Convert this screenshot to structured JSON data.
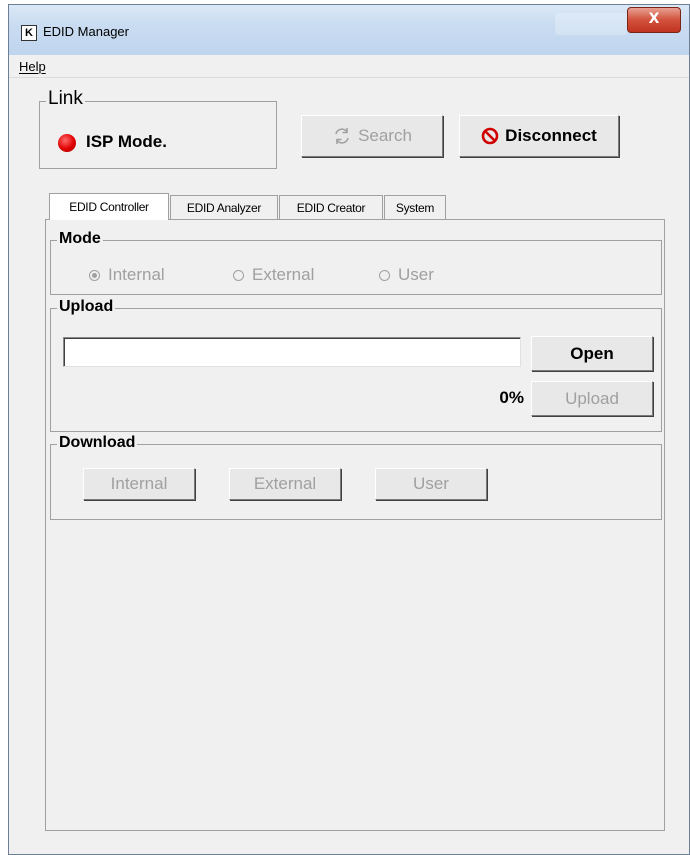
{
  "window": {
    "title": "EDID Manager",
    "app_icon_letter": "K",
    "close_glyph": "X"
  },
  "menu": {
    "help": "Help"
  },
  "link": {
    "group_label": "Link",
    "status_text": "ISP Mode.",
    "status_color": "#e00000",
    "search_label": "Search",
    "search_icon": "refresh-icon",
    "disconnect_label": "Disconnect",
    "disconnect_icon": "prohibited-icon"
  },
  "tabs": [
    {
      "label": "EDID Controller",
      "active": true
    },
    {
      "label": "EDID Analyzer",
      "active": false
    },
    {
      "label": "EDID Creator",
      "active": false
    },
    {
      "label": "System",
      "active": false
    }
  ],
  "mode": {
    "group_label": "Mode",
    "options": [
      {
        "label": "Internal",
        "checked": true
      },
      {
        "label": "External",
        "checked": false
      },
      {
        "label": "User",
        "checked": false
      }
    ]
  },
  "upload": {
    "group_label": "Upload",
    "file_value": "",
    "open_label": "Open",
    "progress": "0%",
    "upload_label": "Upload"
  },
  "download": {
    "group_label": "Download",
    "internal_label": "Internal",
    "external_label": "External",
    "user_label": "User"
  }
}
